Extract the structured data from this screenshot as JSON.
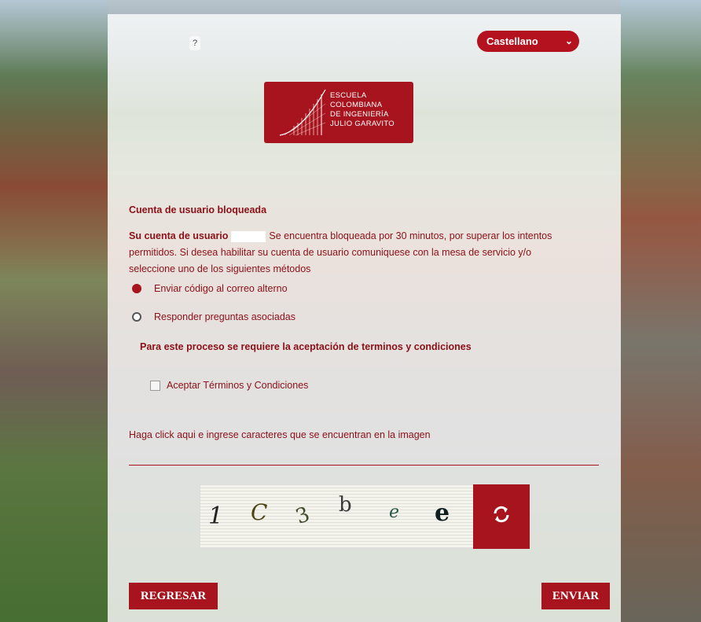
{
  "header": {
    "help_label": "?",
    "language": "Castellano"
  },
  "logo": {
    "lines": [
      "ESCUELA",
      "COLOMBIANA",
      "DE INGENIERÍA",
      "JULIO GARAVITO"
    ]
  },
  "lockout": {
    "title": "Cuenta de usuario bloqueada",
    "msg_bold": "Su cuenta de usuario",
    "msg_rest1": "Se encuentra bloqueada por 30 minutos, por superar los intentos",
    "msg_line2": "permitidos. Si desea habilitar su cuenta de usuario comuniquese con la mesa de servicio y/o",
    "msg_line3": "seleccione uno de los siguientes métodos"
  },
  "methods": [
    {
      "label": "Enviar código al correo alterno",
      "selected": true
    },
    {
      "label": "Responder preguntas asociadas",
      "selected": false
    }
  ],
  "terms": {
    "notice": "Para este proceso se requiere la aceptación de terminos y condiciones",
    "checkbox_label": "Aceptar Términos y Condiciones",
    "checked": false
  },
  "captcha": {
    "hint": "Haga click aqui e ingrese caracteres que se encuentran en la imagen",
    "characters": [
      "1",
      "C",
      "3",
      "b",
      "e",
      "e"
    ]
  },
  "buttons": {
    "back": "REGRESAR",
    "send": "ENVIAR"
  },
  "colors": {
    "accent": "#a8141d",
    "text": "#8b1017"
  }
}
